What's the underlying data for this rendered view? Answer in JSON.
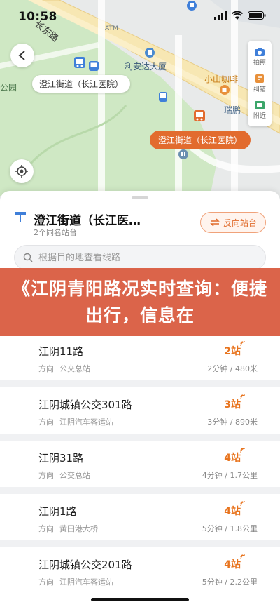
{
  "status": {
    "time": "10:58"
  },
  "map": {
    "road_label": "长东路",
    "atm_label": "ATM",
    "building_label": "利安达大厦",
    "park_label": "公园",
    "cafe_label": "小山咖啡",
    "other_label": "瑞鹏",
    "stop_bubble": "澄江街道（长江医院）",
    "stop_bubble_selected": "澄江街道（长江医院）",
    "tools": [
      {
        "icon": "camera-icon",
        "label": "拍照"
      },
      {
        "icon": "report-icon",
        "label": "纠错"
      },
      {
        "icon": "nearby-icon",
        "label": "附近"
      }
    ]
  },
  "stop": {
    "name": "澄江街道（长江医…",
    "subtitle": "2个同名站台",
    "reverse_label": "反向站台"
  },
  "search": {
    "placeholder": "根据目的地查看线路"
  },
  "banner": {
    "text": "《江阴青阳路况实时查询：便捷出行，信息在"
  },
  "routes": [
    {
      "name": "江阴11路",
      "dir_label": "方向",
      "dest": "公交总站",
      "stations": "2站",
      "eta": "2分钟 / 480米"
    },
    {
      "name": "江阴城镇公交301路",
      "dir_label": "方向",
      "dest": "江阴汽车客运站",
      "stations": "3站",
      "eta": "3分钟 / 890米"
    },
    {
      "name": "江阴31路",
      "dir_label": "方向",
      "dest": "公交总站",
      "stations": "4站",
      "eta": "4分钟 / 1.7公里"
    },
    {
      "name": "江阴1路",
      "dir_label": "方向",
      "dest": "黄田港大桥",
      "stations": "4站",
      "eta": "5分钟 / 1.8公里"
    },
    {
      "name": "江阴城镇公交201路",
      "dir_label": "方向",
      "dest": "江阴汽车客运站",
      "stations": "4站",
      "eta": "5分钟 / 2.2公里"
    }
  ],
  "colors": {
    "accent": "#e8741e",
    "banner": "#d8583c",
    "park": "#cfe8c4"
  }
}
